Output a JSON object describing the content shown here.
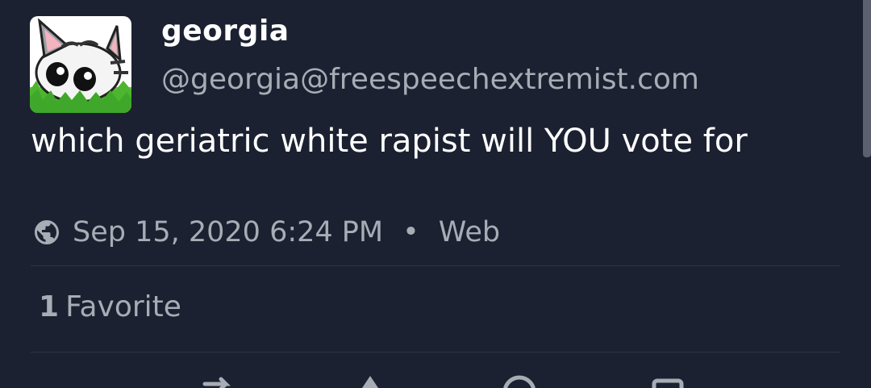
{
  "account": {
    "display_name": "georgia",
    "handle": "@georgia@freespeechextremist.com",
    "avatar_icon": "cat-avatar-icon"
  },
  "status": {
    "text": "which geriatric white rapist will YOU vote for",
    "timestamp": "Sep 15, 2020 6:24 PM",
    "separator": "•",
    "application": "Web",
    "visibility_icon": "globe-icon"
  },
  "stats": {
    "favorite_count": "1",
    "favorite_label": "Favorite"
  },
  "actions": [
    "reply-icon",
    "boost-icon",
    "favorite-icon",
    "bookmark-icon"
  ],
  "colors": {
    "background": "#1b2130",
    "primary_text": "#ffffff",
    "secondary_text": "#a8acb5",
    "divider": "#2c3446"
  }
}
